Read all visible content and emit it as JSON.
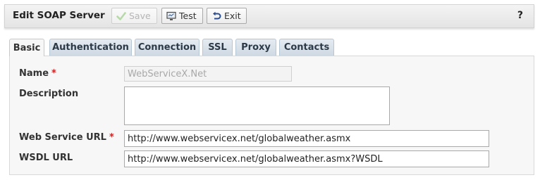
{
  "header": {
    "title": "Edit SOAP Server",
    "save_label": "Save",
    "test_label": "Test",
    "exit_label": "Exit",
    "help_label": "?"
  },
  "tabs": [
    {
      "label": "Basic",
      "active": true
    },
    {
      "label": "Authentication",
      "active": false
    },
    {
      "label": "Connection",
      "active": false
    },
    {
      "label": "SSL",
      "active": false
    },
    {
      "label": "Proxy",
      "active": false
    },
    {
      "label": "Contacts",
      "active": false
    }
  ],
  "form": {
    "name": {
      "label": "Name",
      "required_mark": "*",
      "value": "WebServiceX.Net"
    },
    "description": {
      "label": "Description",
      "value": ""
    },
    "web_service_url": {
      "label": "Web Service URL",
      "required_mark": "*",
      "value": "http://www.webservicex.net/globalweather.asmx"
    },
    "wsdl_url": {
      "label": "WSDL URL",
      "value": "http://www.webservicex.net/globalweather.asmx?WSDL"
    }
  },
  "colors": {
    "required": "#d21f1f",
    "save_icon_disabled": "#b7d9a8",
    "exit_icon": "#2a4d8f"
  },
  "icons": {
    "save": "checkmark-icon",
    "test": "monitor-icon",
    "exit": "return-arrow-icon"
  }
}
